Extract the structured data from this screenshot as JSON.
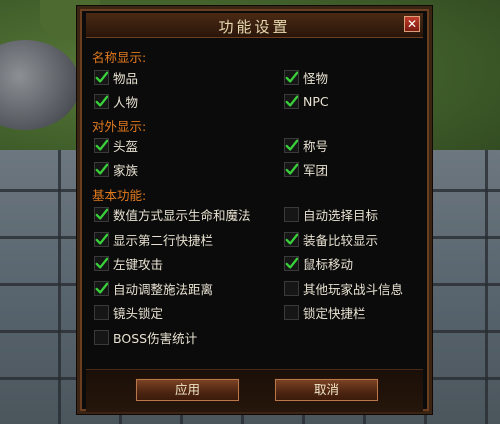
{
  "dialog": {
    "title": "功能设置",
    "close_symbol": "✕",
    "sections": {
      "name_display": "名称显示:",
      "external_display": "对外显示:",
      "basic": "基本功能:"
    },
    "options": [
      {
        "label": "物品",
        "checked": true
      },
      {
        "label": "怪物",
        "checked": true
      },
      {
        "label": "人物",
        "checked": true
      },
      {
        "label": "NPC",
        "checked": true
      },
      {
        "label": "头盔",
        "checked": true
      },
      {
        "label": "称号",
        "checked": true
      },
      {
        "label": "家族",
        "checked": true
      },
      {
        "label": "军团",
        "checked": true
      },
      {
        "label": "数值方式显示生命和魔法",
        "checked": true
      },
      {
        "label": "自动选择目标",
        "checked": false
      },
      {
        "label": "显示第二行快捷栏",
        "checked": true
      },
      {
        "label": "装备比较显示",
        "checked": true
      },
      {
        "label": "左键攻击",
        "checked": true
      },
      {
        "label": "鼠标移动",
        "checked": true
      },
      {
        "label": "自动调整施法距离",
        "checked": true
      },
      {
        "label": "其他玩家战斗信息",
        "checked": false
      },
      {
        "label": "镜头锁定",
        "checked": false
      },
      {
        "label": "锁定快捷栏",
        "checked": false
      },
      {
        "label": "BOSS伤害统计",
        "checked": false
      }
    ],
    "apply_label": "应用",
    "cancel_label": "取消",
    "colors": {
      "section": "#e07a1f",
      "check": "#39d23a",
      "text": "#e8e2d2"
    }
  }
}
